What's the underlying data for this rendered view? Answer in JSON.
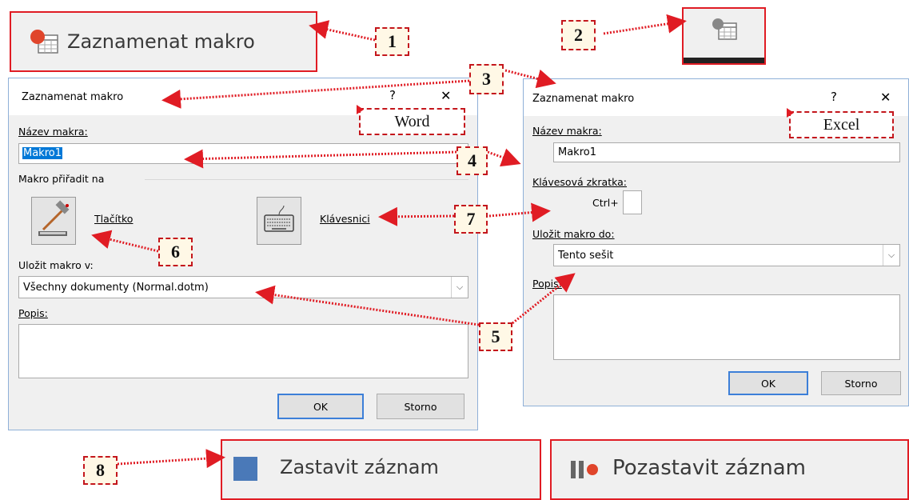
{
  "callout_numbers": [
    "1",
    "2",
    "3",
    "4",
    "5",
    "6",
    "7",
    "8"
  ],
  "ribbon": {
    "record_macro_label": "Zaznamenat makro",
    "stop_recording_label": "Zastavit záznam",
    "pause_recording_label": "Pozastavit záznam"
  },
  "app_labels": {
    "word": "Word",
    "excel": "Excel"
  },
  "word_dialog": {
    "title": "Zaznamenat makro",
    "help": "?",
    "close": "✕",
    "macro_name_label": "Název makra:",
    "macro_name_value": "Makro1",
    "assign_label": "Makro přiřadit na",
    "button_label": "Tlačítko",
    "keyboard_label": "Klávesnici",
    "store_label": "Uložit makro v:",
    "store_value": "Všechny dokumenty (Normal.dotm)",
    "description_label": "Popis:",
    "ok": "OK",
    "cancel": "Storno"
  },
  "excel_dialog": {
    "title": "Zaznamenat makro",
    "help": "?",
    "close": "✕",
    "macro_name_label": "Název makra:",
    "macro_name_value": "Makro1",
    "shortcut_label": "Klávesová zkratka:",
    "ctrl_label": "Ctrl+",
    "store_label": "Uložit makro do:",
    "store_value": "Tento sešit",
    "description_label": "Popis:",
    "ok": "OK",
    "cancel": "Storno"
  },
  "colors": {
    "callout_red": "#e01c24",
    "stop_blue": "#4a79b8",
    "record_red": "#e0452b",
    "selection_blue": "#0078d7"
  }
}
